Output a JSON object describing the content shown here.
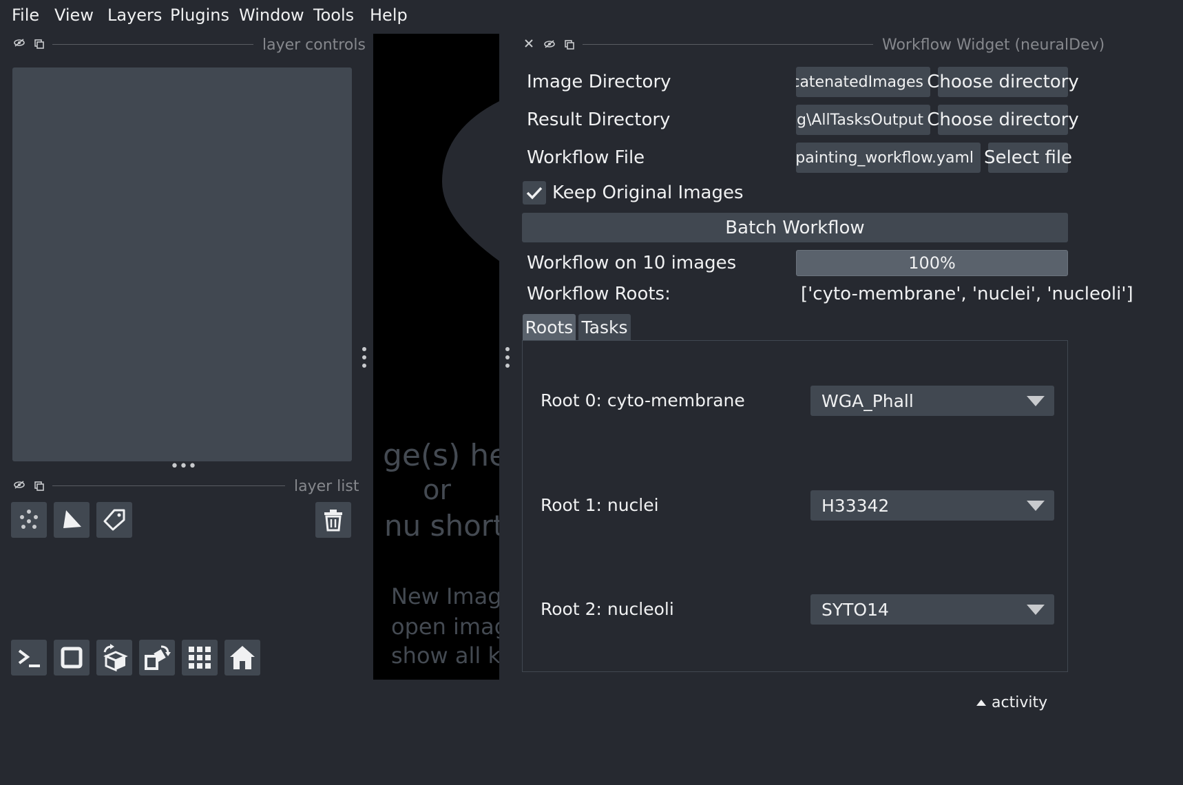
{
  "menu": {
    "items": [
      {
        "label": "File"
      },
      {
        "label": "View"
      },
      {
        "label": "Layers"
      },
      {
        "label": "Plugins"
      },
      {
        "label": "Window"
      },
      {
        "label": "Tools"
      },
      {
        "label": "Help"
      }
    ]
  },
  "layer_controls": {
    "title": "layer controls"
  },
  "layer_list": {
    "title": "layer list"
  },
  "canvas": {
    "lines": [
      "ge(s) here",
      "or",
      "nu short",
      "New Image",
      "open image",
      "show all k"
    ]
  },
  "widget": {
    "title": "Workflow Widget (neuralDev)",
    "image_directory": {
      "label": "Image Directory",
      "value": "ConcatenatedImages",
      "button": "Choose directory"
    },
    "result_directory": {
      "label": "Result Directory",
      "value": "nting\\AllTasksOutput",
      "button": "Choose directory"
    },
    "workflow_file": {
      "label": "Workflow File",
      "value": "l_cellpainting_workflow.yaml",
      "button": "Select file"
    },
    "keep_original": {
      "label": "Keep Original Images",
      "checked": true
    },
    "batch_button": "Batch Workflow",
    "progress": {
      "label": "Workflow on 10 images",
      "value_text": "100%",
      "percent": 100
    },
    "roots": {
      "label": "Workflow Roots:",
      "value": "['cyto-membrane', 'nuclei', 'nucleoli']"
    },
    "tabs": [
      {
        "label": "Roots",
        "active": true
      },
      {
        "label": "Tasks",
        "active": false
      }
    ],
    "root_rows": [
      {
        "label": "Root 0: cyto-membrane",
        "selected": "WGA_Phall"
      },
      {
        "label": "Root 1: nuclei",
        "selected": "H33342"
      },
      {
        "label": "Root 2: nucleoli",
        "selected": "SYTO14"
      }
    ]
  },
  "status": {
    "activity": "activity"
  },
  "colors": {
    "background": "#262930",
    "panel": "#414851",
    "text": "#f0f1f2",
    "muted": "#86888d"
  }
}
